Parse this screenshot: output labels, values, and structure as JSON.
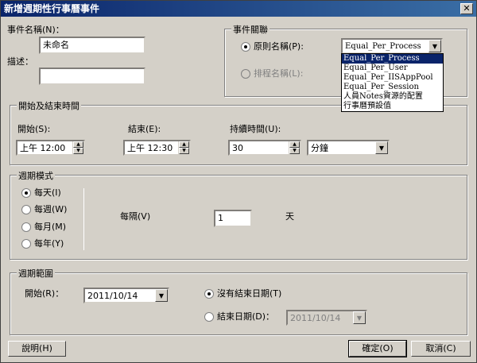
{
  "window": {
    "title": "新增週期性行事曆事件",
    "close_glyph": "✕"
  },
  "event_name": {
    "label": "事件名稱(N)：",
    "value": "未命名"
  },
  "description": {
    "label": "描述：",
    "value": ""
  },
  "event_link": {
    "group_title": "事件關聯",
    "rule_name_label": "原則名稱(P):",
    "rule_name_value": "Equal_Per_Process",
    "schedule_name_label": "排程名稱(L):",
    "options": [
      "Equal_Per_Process",
      "Equal_Per_User",
      "Equal_Per_IISAppPool",
      "Equal_Per_Session",
      "人員Notes資源的配置",
      "行事曆預設值"
    ]
  },
  "time": {
    "group_title": "開始及結束時間",
    "start_label": "開始(S):",
    "start_value": "上午 12:00",
    "end_label": "結束(E):",
    "end_value": "上午 12:30",
    "duration_label": "持續時間(U):",
    "duration_value": "30",
    "duration_unit": "分鐘"
  },
  "pattern": {
    "group_title": "週期模式",
    "options": [
      "每天(I)",
      "每週(W)",
      "每月(M)",
      "每年(Y)"
    ],
    "every_label": "每隔(V)",
    "every_value": "1",
    "every_unit": "天"
  },
  "range": {
    "group_title": "週期範圍",
    "start_label": "開始(R)：",
    "start_value": "2011/10/14",
    "no_end_label": "沒有結束日期(T)",
    "end_date_label": "結束日期(D)：",
    "end_date_value": "2011/10/14"
  },
  "buttons": {
    "help": "說明(H)",
    "ok": "確定(O)",
    "cancel": "取消(C)"
  }
}
